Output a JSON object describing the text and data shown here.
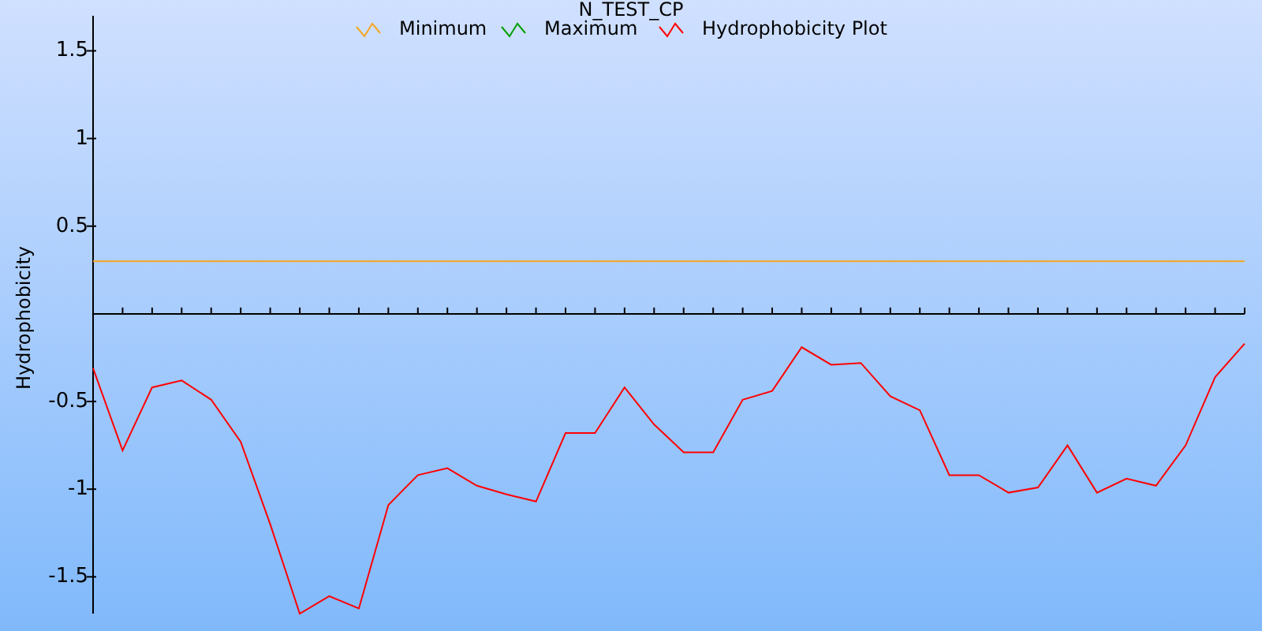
{
  "chart_data": {
    "type": "line",
    "title": "N_TEST_CP",
    "ylabel": "Hydrophobicity",
    "categories": [
      null,
      null,
      null,
      null,
      null,
      null,
      null,
      null,
      null,
      null,
      null,
      null,
      null,
      null,
      null,
      null,
      null,
      null,
      null,
      null,
      null,
      null,
      null,
      null,
      null,
      null,
      null,
      null,
      null,
      null,
      null,
      null,
      null,
      null,
      null,
      null,
      null,
      null,
      null,
      null
    ],
    "ylim": [
      -1.71,
      1.7
    ],
    "legend": "top",
    "yticks": [
      1.5,
      1,
      0.5,
      -0.5,
      -1,
      -1.5
    ],
    "series": [
      {
        "name": "Minimum",
        "color": "#f5a623",
        "values": [
          0.3,
          0.3,
          0.3,
          0.3,
          0.3,
          0.3,
          0.3,
          0.3,
          0.3,
          0.3,
          0.3,
          0.3,
          0.3,
          0.3,
          0.3,
          0.3,
          0.3,
          0.3,
          0.3,
          0.3,
          0.3,
          0.3,
          0.3,
          0.3,
          0.3,
          0.3,
          0.3,
          0.3,
          0.3,
          0.3,
          0.3,
          0.3,
          0.3,
          0.3,
          0.3,
          0.3,
          0.3,
          0.3,
          0.3,
          0.3
        ]
      },
      {
        "name": "Maximum",
        "color": "#00a000",
        "values": [
          null,
          null,
          null,
          null,
          null,
          null,
          null,
          null,
          null,
          null,
          null,
          null,
          null,
          null,
          null,
          null,
          null,
          null,
          null,
          null,
          null,
          null,
          null,
          null,
          null,
          null,
          null,
          null,
          null,
          null,
          null,
          null,
          null,
          null,
          null,
          null,
          null,
          null,
          null,
          null
        ]
      },
      {
        "name": "Hydrophobicity Plot",
        "color": "#ff0000",
        "values": [
          -0.31,
          -0.78,
          -0.42,
          -0.38,
          -0.49,
          -0.73,
          -1.2,
          -1.71,
          -1.61,
          -1.68,
          -1.09,
          -0.92,
          -0.88,
          -0.98,
          -1.03,
          -1.07,
          -0.68,
          -0.68,
          -0.42,
          -0.63,
          -0.79,
          -0.79,
          -0.49,
          -0.44,
          -0.19,
          -0.29,
          -0.28,
          -0.47,
          -0.55,
          -0.92,
          -0.92,
          -1.02,
          -0.99,
          -0.75,
          -1.02,
          -0.94,
          -0.98,
          -0.75,
          -0.36,
          -0.17
        ]
      }
    ]
  }
}
